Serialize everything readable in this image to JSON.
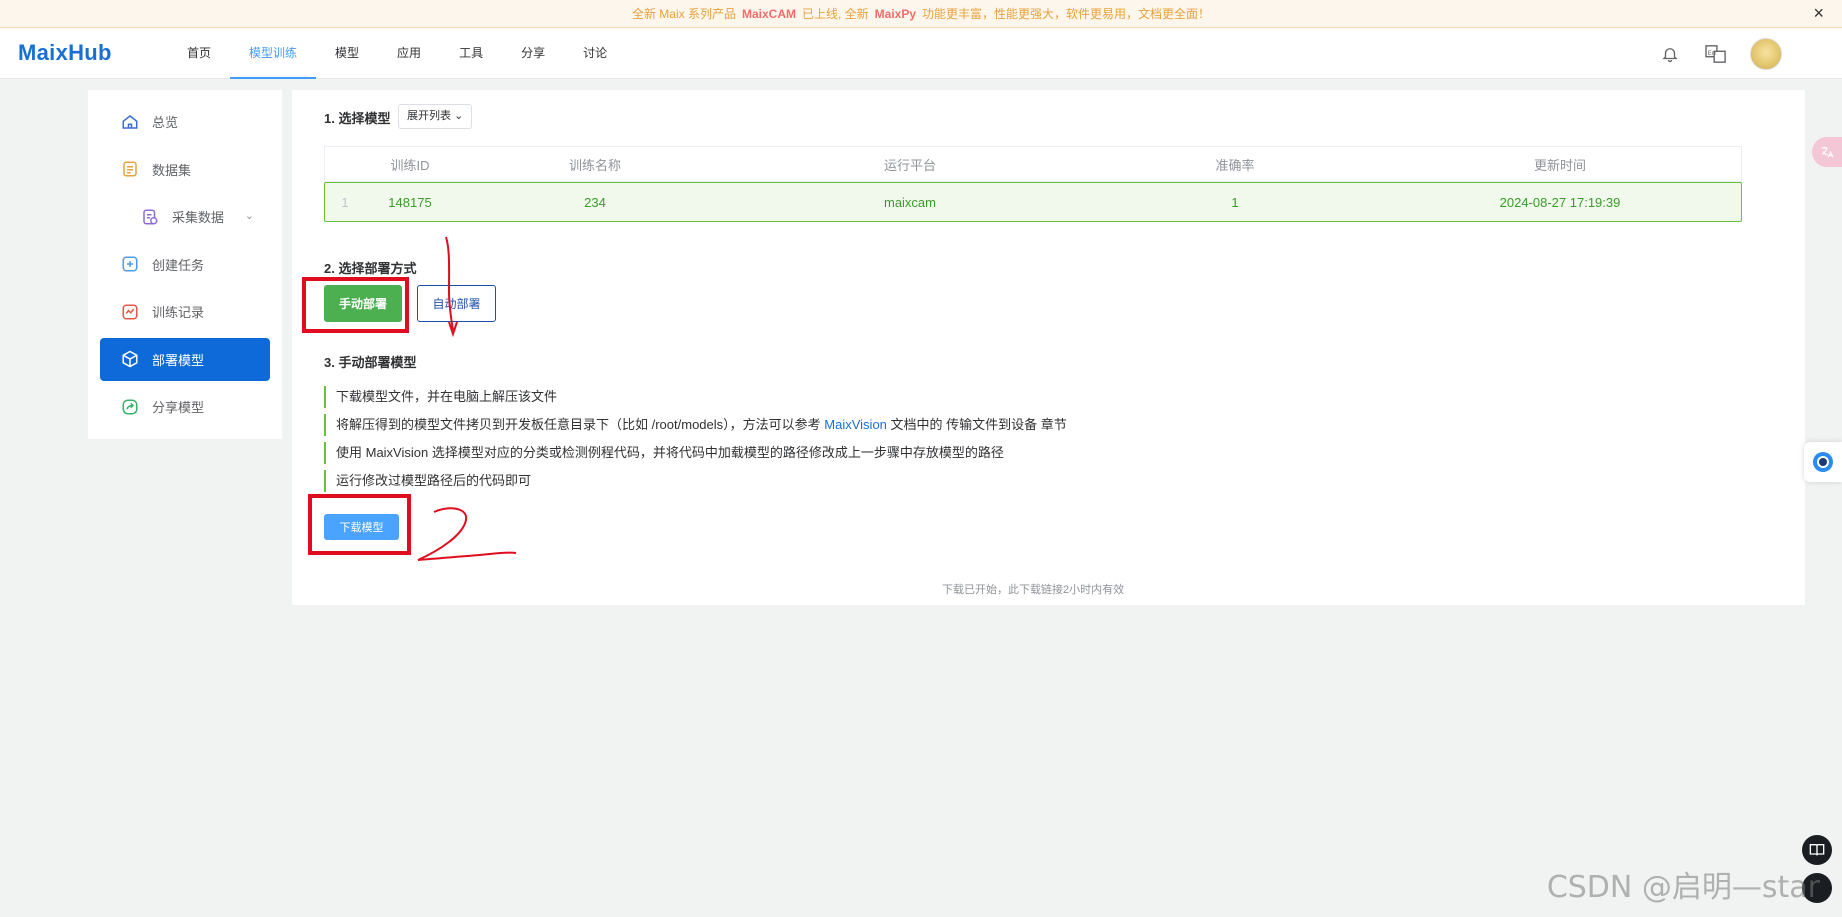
{
  "announcement": {
    "pre": "全新 Maix 系列产品",
    "highlight1": "MaixCAM",
    "mid": "已上线, 全新",
    "highlight2": "MaixPy",
    "post": "功能更丰富，性能更强大，软件更易用，文档更全面！",
    "close": "×"
  },
  "header": {
    "logo": "MaixHub",
    "nav": [
      "首页",
      "模型训练",
      "模型",
      "应用",
      "工具",
      "分享",
      "讨论"
    ],
    "active_nav": "模型训练",
    "icons": [
      "bell-icon",
      "translate-icon",
      "avatar"
    ]
  },
  "sidebar": {
    "items": [
      {
        "label": "总览",
        "icon": "home-icon"
      },
      {
        "label": "数据集",
        "icon": "dataset-icon"
      },
      {
        "label": "采集数据",
        "icon": "collect-icon"
      },
      {
        "label": "创建任务",
        "icon": "plus-icon"
      },
      {
        "label": "训练记录",
        "icon": "record-icon"
      },
      {
        "label": "部署模型",
        "icon": "cube-icon"
      },
      {
        "label": "分享模型",
        "icon": "share-icon"
      }
    ],
    "active": "部署模型"
  },
  "main": {
    "step1_title": "1. 选择模型",
    "dropdown_label": "展开列表",
    "table": {
      "headers": [
        "训练ID",
        "训练名称",
        "运行平台",
        "准确率",
        "更新时间"
      ],
      "row": {
        "index": "1",
        "id": "148175",
        "name": "234",
        "platform": "maixcam",
        "accuracy": "1",
        "updated": "2024-08-27 17:19:39"
      }
    },
    "step2_title": "2. 选择部署方式",
    "manual_button": "手动部署",
    "auto_button": "自动部署",
    "step3_title": "3. 手动部署模型",
    "steps": {
      "s1": "下载模型文件，并在电脑上解压该文件",
      "s2_pre": "将解压得到的模型文件拷贝到开发板任意目录下（比如 /root/models），方法可以参考",
      "s2_link": "MaixVision",
      "s2_post": "文档中的 传输文件到设备 章节",
      "s3": "使用 MaixVision 选择模型对应的分类或检测例程代码，并将代码中加载模型的路径修改成上一步骤中存放模型的路径",
      "s4": "运行修改过模型路径后的代码即可"
    },
    "download_button": "下载模型",
    "hint": "下载已开始，此下载链接2小时内有效"
  },
  "watermark": "CSDN @启明—star",
  "colors": {
    "brand": "#1a6fd6",
    "accent": "#409eff",
    "success": "#67c23a",
    "annotation": "#e00d1f"
  }
}
